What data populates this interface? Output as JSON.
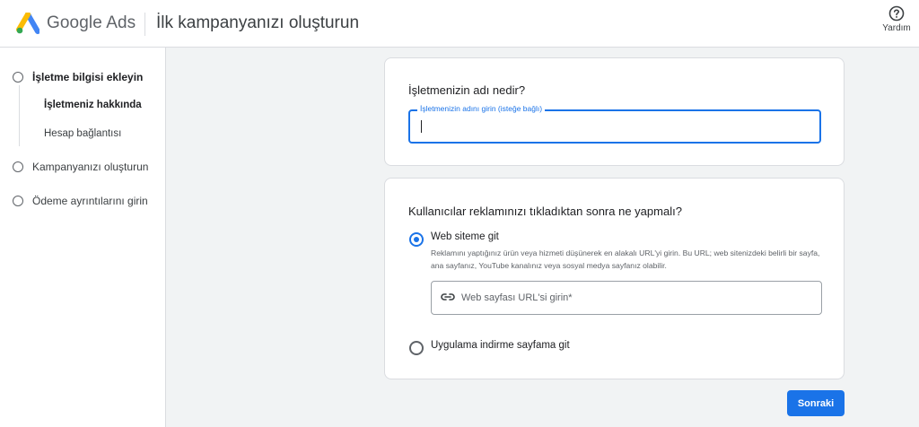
{
  "header": {
    "brand": "Google Ads",
    "title": "İlk kampanyanızı oluşturun",
    "help_label": "Yardım",
    "colors": {
      "blue": "#4285f4",
      "yellow": "#fbbc04",
      "green": "#34a853"
    }
  },
  "sidebar": {
    "steps": [
      {
        "label": "İşletme bilgisi ekleyin",
        "active": true
      },
      {
        "label": "Kampanyanızı oluşturun",
        "active": false
      },
      {
        "label": "Ödeme ayrıntılarını girin",
        "active": false
      }
    ],
    "substeps": [
      {
        "label": "İşletmeniz hakkında",
        "active": true
      },
      {
        "label": "Hesap bağlantısı",
        "active": false
      }
    ]
  },
  "business_card": {
    "question": "İşletmenizin adı nedir?",
    "field_label": "İşletmenizin adını girin (isteğe bağlı)",
    "field_value": ""
  },
  "action_card": {
    "question": "Kullanıcılar reklamınızı tıkladıktan sonra ne yapmalı?",
    "options": [
      {
        "label": "Web siteme git",
        "selected": true,
        "description": "Reklamını yaptığınız ürün veya hizmeti düşünerek en alakalı URL'yi girin. Bu URL; web sitenizdeki belirli bir sayfa, ana sayfanız, YouTube kanalınız veya sosyal medya sayfanız olabilir.",
        "url_placeholder": "Web sayfası URL'si girin*",
        "link_icon": "link-icon"
      },
      {
        "label": "Uygulama indirme sayfama git",
        "selected": false
      }
    ]
  },
  "footer": {
    "next_label": "Sonraki",
    "accent": "#1a73e8"
  }
}
